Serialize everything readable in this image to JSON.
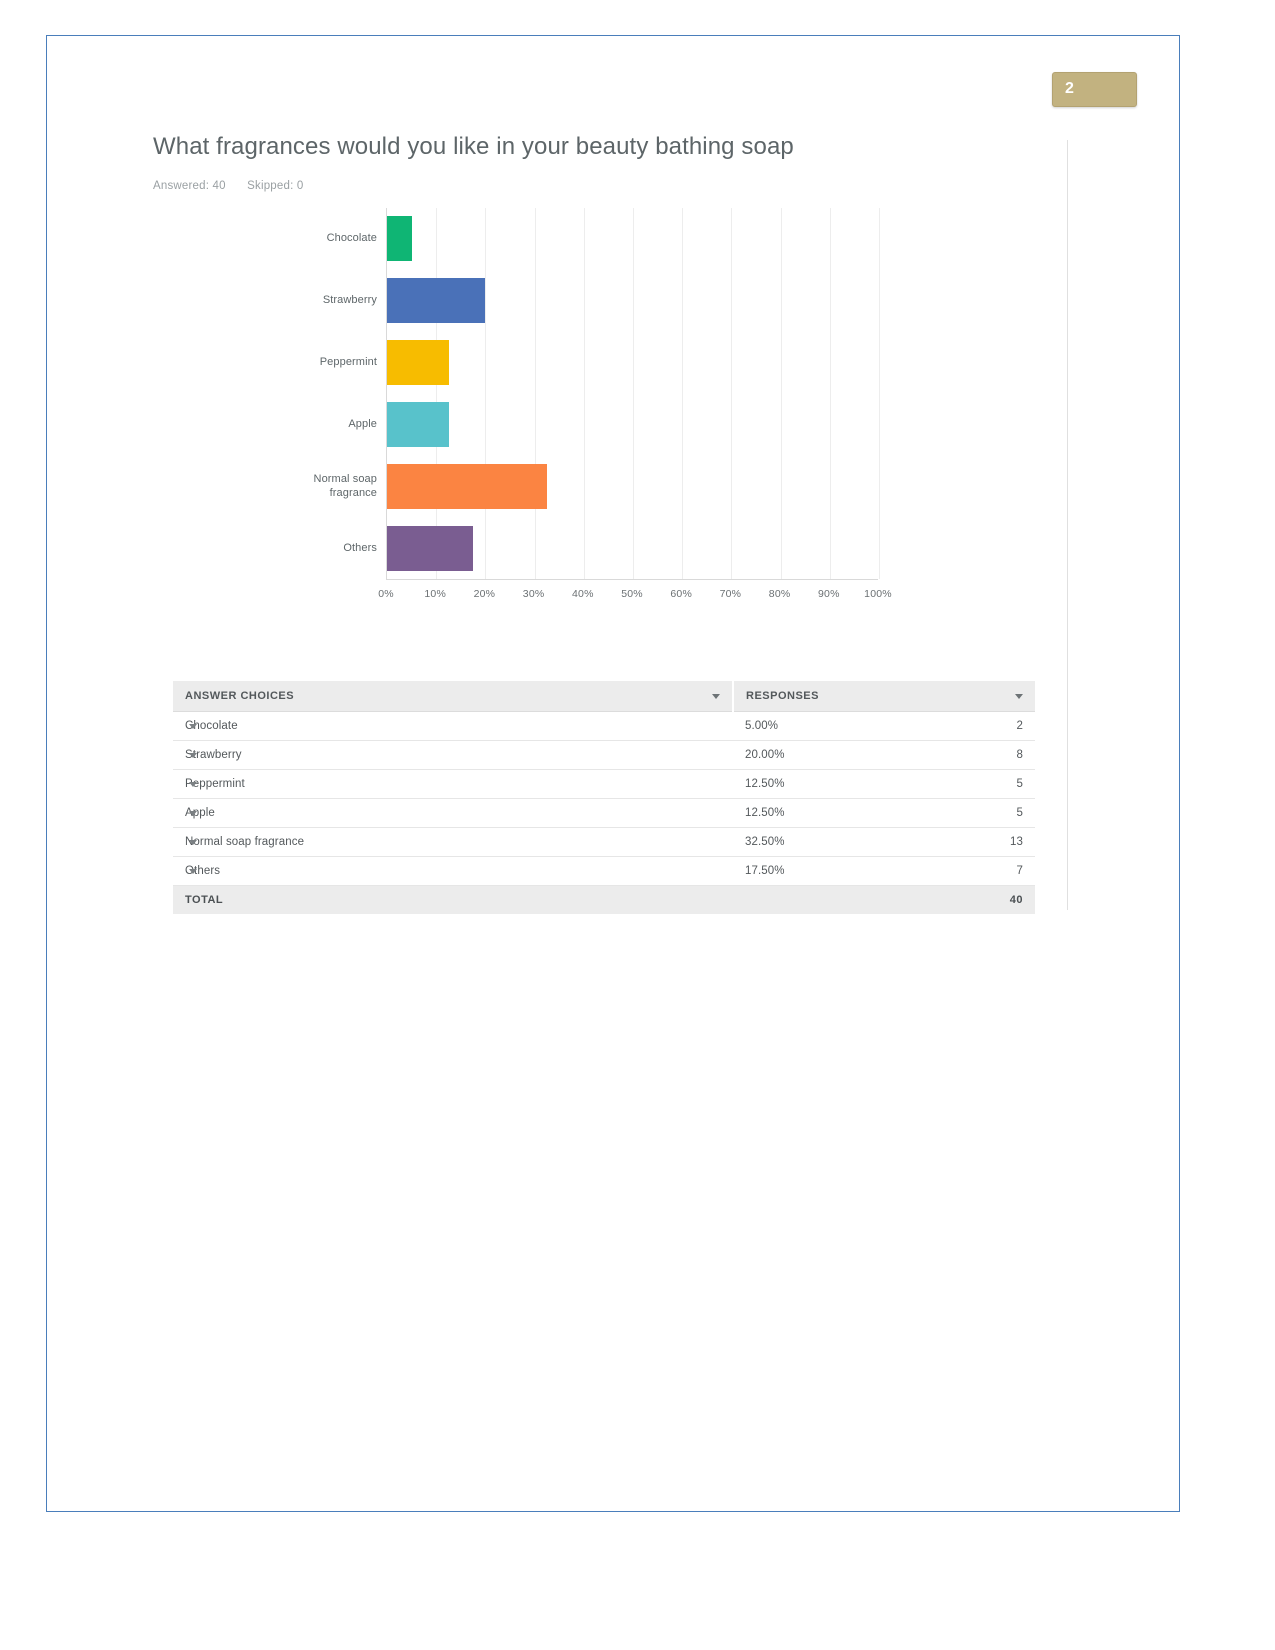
{
  "page_badge": {
    "number": "2"
  },
  "question": {
    "title": "What fragrances would you like in your beauty bathing soap",
    "answered_label": "Answered: 40",
    "skipped_label": "Skipped: 0"
  },
  "chart_data": {
    "type": "bar",
    "orientation": "horizontal",
    "title": "What fragrances would you like in your beauty bathing soap",
    "xlabel": "",
    "ylabel": "",
    "xlim": [
      0,
      100
    ],
    "grid": true,
    "legend": "none",
    "categories": [
      "Chocolate",
      "Strawberry",
      "Peppermint",
      "Apple",
      "Normal soap fragrance",
      "Others"
    ],
    "values": [
      5.0,
      20.0,
      12.5,
      12.5,
      32.5,
      17.5
    ],
    "counts": [
      2,
      8,
      5,
      5,
      13,
      7
    ],
    "colors": [
      "#0fb574",
      "#4a71b8",
      "#f7bc00",
      "#58c2cb",
      "#fb8442",
      "#7a5d91"
    ],
    "tick_labels": [
      "0%",
      "10%",
      "20%",
      "30%",
      "40%",
      "50%",
      "60%",
      "70%",
      "80%",
      "90%",
      "100%"
    ],
    "tick_values": [
      0,
      10,
      20,
      30,
      40,
      50,
      60,
      70,
      80,
      90,
      100
    ]
  },
  "table": {
    "headers": {
      "choices": "ANSWER CHOICES",
      "responses": "RESPONSES"
    },
    "rows": [
      {
        "choice": "Chocolate",
        "percent": "5.00%",
        "count": "2"
      },
      {
        "choice": "Strawberry",
        "percent": "20.00%",
        "count": "8"
      },
      {
        "choice": "Peppermint",
        "percent": "12.50%",
        "count": "5"
      },
      {
        "choice": "Apple",
        "percent": "12.50%",
        "count": "5"
      },
      {
        "choice": "Normal soap fragrance",
        "percent": "32.50%",
        "count": "13"
      },
      {
        "choice": "Others",
        "percent": "17.50%",
        "count": "7"
      }
    ],
    "total": {
      "label": "TOTAL",
      "value": "40"
    }
  }
}
